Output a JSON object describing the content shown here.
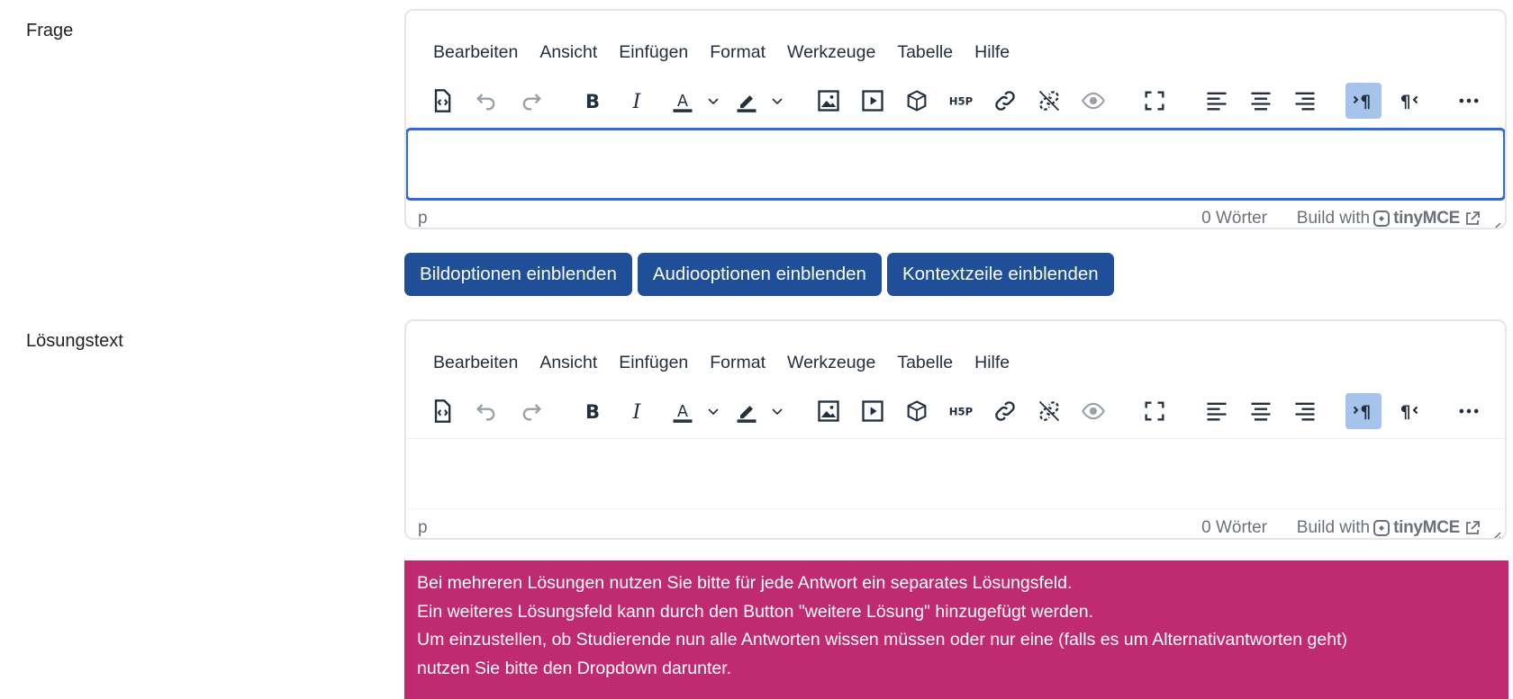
{
  "fields": {
    "question": {
      "label": "Frage",
      "status_path": "p",
      "word_count": "0 Wörter",
      "build_with": "Build with",
      "brand": "tinyMCE"
    },
    "solution": {
      "label": "Lösungstext",
      "status_path": "p",
      "word_count": "0 Wörter",
      "build_with": "Build with",
      "brand": "tinyMCE"
    }
  },
  "menubar": [
    "Bearbeiten",
    "Ansicht",
    "Einfügen",
    "Format",
    "Werkzeuge",
    "Tabelle",
    "Hilfe"
  ],
  "toolbar_icons": [
    "source-code",
    "undo",
    "redo",
    "bold",
    "italic",
    "text-color",
    "highlight-color",
    "image",
    "media",
    "h5p-content",
    "h5p-logo",
    "link",
    "unlink",
    "preview",
    "fullscreen",
    "align-left",
    "align-center",
    "align-right",
    "ltr",
    "rtl",
    "more"
  ],
  "buttons": {
    "image_options": "Bildoptionen einblenden",
    "audio_options": "Audiooptionen einblenden",
    "context_line": "Kontextzeile einblenden"
  },
  "alert": {
    "line1": "Bei mehreren Lösungen nutzen Sie bitte für jede Antwort ein separates Lösungsfeld.",
    "line2": "Ein weiteres Lösungsfeld kann durch den Button \"weitere Lösung\" hinzugefügt werden.",
    "line3": "Um einzustellen, ob Studierende nun alle Antworten wissen müssen oder nur eine (falls es um Alternativantworten geht)",
    "line4": "nutzen Sie bitte den Dropdown darunter."
  },
  "colors": {
    "primary_button": "#1f4f99",
    "alert_bg": "#bf2a70",
    "focus_border": "#2d6ada",
    "active_toggle": "#a6c3ec"
  }
}
